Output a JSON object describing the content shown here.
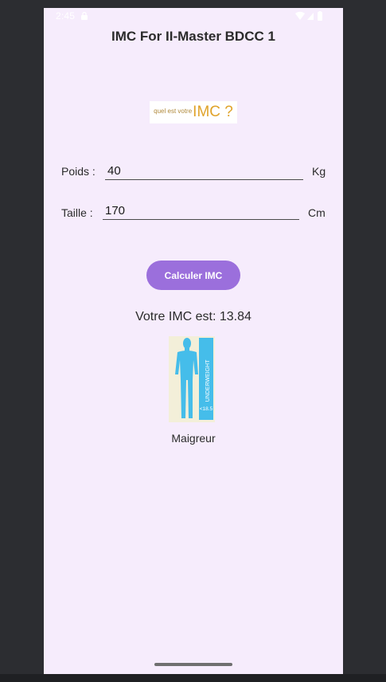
{
  "status_bar": {
    "time": "2:45",
    "icons": [
      "lock-icon",
      "wifi-icon",
      "signal-icon",
      "battery-icon"
    ]
  },
  "app": {
    "title": "IMC For II-Master BDCC 1"
  },
  "logo": {
    "small_text": "quel est votre",
    "big_text": "IMC ?"
  },
  "form": {
    "weight": {
      "label": "Poids :",
      "value": "40",
      "unit": "Kg"
    },
    "height": {
      "label": "Taille :",
      "value": "170",
      "unit": "Cm"
    }
  },
  "actions": {
    "calculate_label": "Calculer IMC"
  },
  "result": {
    "text": "Votre IMC est: 13.84",
    "category": "Maigreur"
  },
  "illustration": {
    "text": "UNDERWEIGHT",
    "threshold": "<18.5"
  },
  "colors": {
    "background": "#f6ecfc",
    "accent": "#9b6fdc",
    "figure_blue": "#45bdea",
    "illustration_bg": "#f3efd9"
  }
}
